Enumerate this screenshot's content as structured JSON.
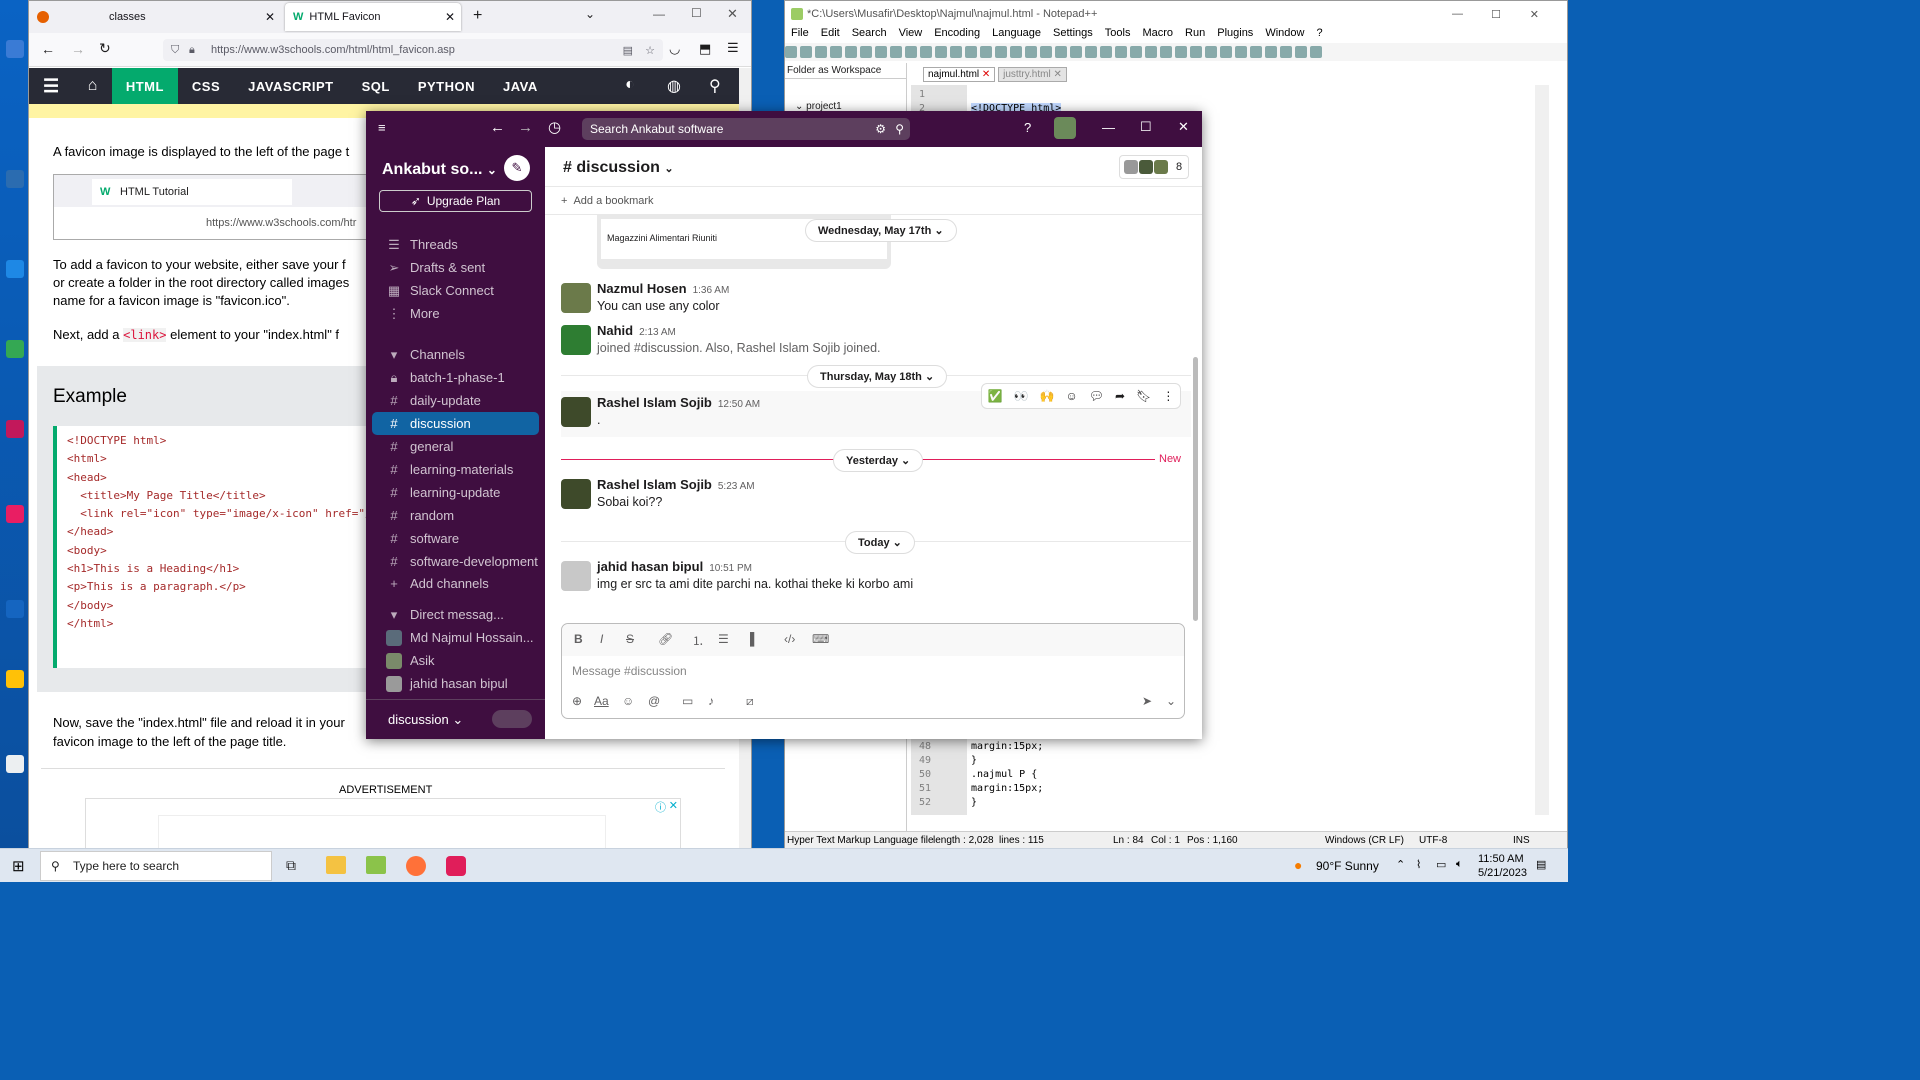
{
  "firefox": {
    "tabs": [
      {
        "label": "classes"
      },
      {
        "label": "HTML Favicon"
      }
    ],
    "url": "https://www.w3schools.com/html/html_favicon.asp",
    "nav": [
      "HTML",
      "CSS",
      "JAVASCRIPT",
      "SQL",
      "PYTHON",
      "JAVA"
    ],
    "p1": "A favicon image is displayed to the left of the page t",
    "inner_tab": "HTML Tutorial",
    "inner_url": "https://www.w3schools.com/htr",
    "p2a": "To add a favicon to your website, either save your f",
    "p2b": "or create a folder in the root directory called images",
    "p2c": "name for a favicon image is \"favicon.ico\".",
    "p3a": "Next, add a",
    "p3code": "<link>",
    "p3b": "element to your \"index.html\" f",
    "example_title": "Example",
    "code": [
      "<!DOCTYPE html>",
      "<html>",
      "<head>",
      "  <title>My Page Title</title>",
      "  <link rel=\"icon\" type=\"image/x-icon\" href=\"/",
      "</head>",
      "<body>",
      "",
      "<h1>This is a Heading</h1>",
      "<p>This is a paragraph.</p>",
      "",
      "</body>",
      "</html>"
    ],
    "p4a": "Now, save the \"index.html\" file and reload it in your",
    "p4b": "favicon image to the left of the page title.",
    "ad_label": "ADVERTISEMENT"
  },
  "notepad": {
    "title": "*C:\\Users\\Musafir\\Desktop\\Najmul\\najmul.html - Notepad++",
    "menu": [
      "File",
      "Edit",
      "Search",
      "View",
      "Encoding",
      "Language",
      "Settings",
      "Tools",
      "Macro",
      "Run",
      "Plugins",
      "Window",
      "?"
    ],
    "panel_title": "Folder as Workspace",
    "tree_item": "project1",
    "tabs": [
      "najmul.html",
      "justtry.html"
    ],
    "top_lines": [
      {
        "n": "1",
        "t": ""
      },
      {
        "n": "2",
        "t": "<!DOCTYPE html>"
      }
    ],
    "bottom_lines": [
      {
        "n": "48",
        "t": "margin:15px;"
      },
      {
        "n": "49",
        "t": "}"
      },
      {
        "n": "50",
        "t": ".najmul P {"
      },
      {
        "n": "51",
        "t": "margin:15px;"
      },
      {
        "n": "52",
        "t": "}"
      }
    ],
    "status": {
      "type": "Hyper Text Markup Language file",
      "length": "length : 2,028",
      "lines": "lines : 115",
      "ln": "Ln : 84",
      "col": "Col : 1",
      "pos": "Pos : 1,160",
      "eol": "Windows (CR LF)",
      "enc": "UTF-8",
      "mode": "INS"
    }
  },
  "slack": {
    "search": "Search Ankabut software",
    "workspace": "Ankabut so...",
    "upgrade": "Upgrade Plan",
    "nav": [
      {
        "label": "Threads",
        "icon": "threads-icon"
      },
      {
        "label": "Drafts & sent",
        "icon": "send-icon"
      },
      {
        "label": "Slack Connect",
        "icon": "building-icon"
      },
      {
        "label": "More",
        "icon": "more-icon"
      }
    ],
    "channels_header": "Channels",
    "channels": [
      {
        "name": "batch-1-phase-1",
        "locked": true
      },
      {
        "name": "daily-update"
      },
      {
        "name": "discussion",
        "selected": true
      },
      {
        "name": "general"
      },
      {
        "name": "learning-materials"
      },
      {
        "name": "learning-update"
      },
      {
        "name": "random"
      },
      {
        "name": "software"
      },
      {
        "name": "software-development"
      }
    ],
    "add_channels": "Add channels",
    "dm_header": "Direct messag...",
    "dms": [
      "Md Najmul Hossain...",
      "Asik",
      "jahid hasan bipul"
    ],
    "footer_channel": "discussion",
    "channel_title": "# discussion",
    "member_count": "8",
    "bookmark": "Add a bookmark",
    "preview_text": "Magazzini Alimentari Riuniti",
    "date1": "Wednesday, May 17th",
    "date2": "Thursday, May 18th",
    "date3": "Yesterday",
    "date4": "Today",
    "new_label": "New",
    "messages": [
      {
        "name": "Nazmul Hosen",
        "time": "1:36 AM",
        "text": "You can use any color"
      },
      {
        "name": "Nahid",
        "time": "2:13 AM",
        "text": "joined #discussion. Also, Rashel Islam Sojib joined."
      },
      {
        "name": "Rashel Islam Sojib",
        "time": "12:50 AM",
        "text": "."
      },
      {
        "name": "Rashel Islam Sojib",
        "time": "5:23 AM",
        "text": "Sobai koi??"
      },
      {
        "name": "jahid hasan bipul",
        "time": "10:51 PM",
        "text": "img er src ta ami dite parchi na. kothai theke ki korbo ami"
      }
    ],
    "composer_placeholder": "Message #discussion"
  },
  "taskbar": {
    "search": "Type here to search",
    "weather": "90°F  Sunny",
    "time": "11:50 AM",
    "date": "5/21/2023"
  }
}
